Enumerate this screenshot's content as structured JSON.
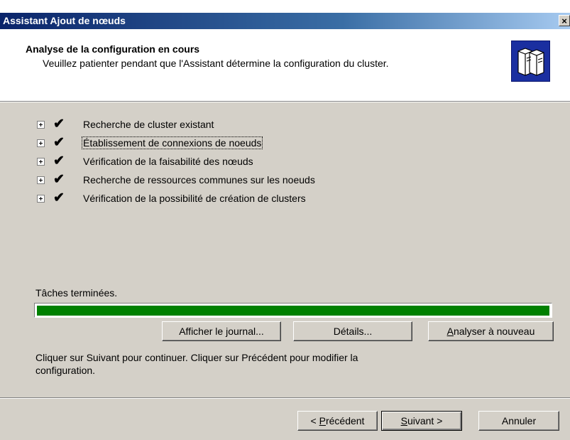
{
  "window": {
    "title": "Assistant Ajout de nœuds",
    "close_label": "×"
  },
  "header": {
    "title": "Analyse de la configuration en cours",
    "subtitle": "Veuillez patienter pendant que l'Assistant détermine la configuration du cluster.",
    "icon": "servers-icon"
  },
  "tree": {
    "items": [
      {
        "label": "Recherche de cluster existant",
        "status": "done"
      },
      {
        "label": "Établissement de connexions de noeuds",
        "status": "done",
        "selected": true
      },
      {
        "label": "Vérification de la faisabilité des nœuds",
        "status": "done"
      },
      {
        "label": "Recherche de ressources communes sur les noeuds",
        "status": "done"
      },
      {
        "label": "Vérification de la possibilité de création de clusters",
        "status": "done"
      }
    ],
    "check_glyph": "✔"
  },
  "status_text": "Tâches terminées.",
  "progress": {
    "fraction": 1.0,
    "color": "#008000"
  },
  "buttons": {
    "view_log": "Afficher le journal...",
    "details": "Détails...",
    "reanalyze_key": "A",
    "reanalyze_rest": "nalyser à nouveau"
  },
  "instructions": "Cliquer sur Suivant pour continuer. Cliquer sur Précédent pour modifier la configuration.",
  "footer": {
    "back_prefix": "< ",
    "back_key": "P",
    "back_rest": "récédent",
    "next_key": "S",
    "next_rest": "uivant >",
    "cancel": "Annuler"
  }
}
